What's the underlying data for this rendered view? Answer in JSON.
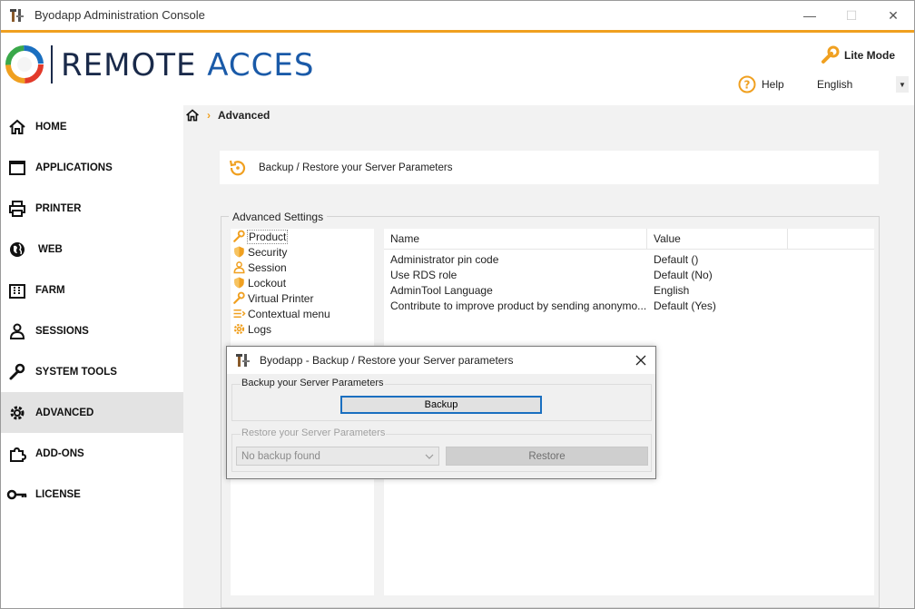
{
  "window": {
    "title": "Byodapp Administration Console",
    "minimize": "—",
    "maximize": "☐",
    "close": "✕"
  },
  "header": {
    "logo_text_left": "REMOTE ",
    "logo_text_right": "ACCES",
    "lite_mode_label": "Lite Mode",
    "help_label": "Help",
    "language_selected": "English"
  },
  "sidebar": {
    "items": [
      {
        "label": "HOME",
        "icon": "home-icon"
      },
      {
        "label": "APPLICATIONS",
        "icon": "window-icon"
      },
      {
        "label": "PRINTER",
        "icon": "printer-icon"
      },
      {
        "label": "WEB",
        "icon": "globe-icon"
      },
      {
        "label": "FARM",
        "icon": "building-icon"
      },
      {
        "label": "SESSIONS",
        "icon": "user-icon"
      },
      {
        "label": "SYSTEM TOOLS",
        "icon": "wrench-icon"
      },
      {
        "label": "ADVANCED",
        "icon": "gear-icon",
        "active": true
      },
      {
        "label": "ADD-ONS",
        "icon": "puzzle-icon"
      },
      {
        "label": "LICENSE",
        "icon": "key-icon"
      }
    ]
  },
  "breadcrumb": {
    "current": "Advanced"
  },
  "banner": {
    "text": "Backup / Restore your Server Parameters"
  },
  "advanced_settings": {
    "legend": "Advanced Settings",
    "categories": [
      {
        "label": "Product",
        "icon": "wrench-icon"
      },
      {
        "label": "Security",
        "icon": "shield-icon"
      },
      {
        "label": "Session",
        "icon": "user-icon"
      },
      {
        "label": "Lockout",
        "icon": "shield-icon"
      },
      {
        "label": "Virtual Printer",
        "icon": "wrench-icon"
      },
      {
        "label": "Contextual menu",
        "icon": "menu-icon"
      },
      {
        "label": "Logs",
        "icon": "gear-icon"
      }
    ],
    "columns": [
      "Name",
      "Value"
    ],
    "rows": [
      {
        "name": "Administrator pin code",
        "value": "Default ()"
      },
      {
        "name": "Use RDS role",
        "value": "Default (No)"
      },
      {
        "name": "AdminTool Language",
        "value": "English"
      },
      {
        "name": "Contribute to improve product by sending anonymo...",
        "value": "Default (Yes)"
      }
    ]
  },
  "dialog": {
    "title": "Byodapp -  Backup / Restore your Server parameters",
    "backup_group_label": "Backup your Server Parameters",
    "backup_button": "Backup",
    "restore_group_label": "Restore your Server Parameters",
    "restore_select_value": "No backup found",
    "restore_button": "Restore"
  },
  "colors": {
    "accent_orange": "#f0a020",
    "brand_navy": "#1a2a4a",
    "brand_blue": "#1a5aa8",
    "focus_blue": "#1a6fc0"
  }
}
